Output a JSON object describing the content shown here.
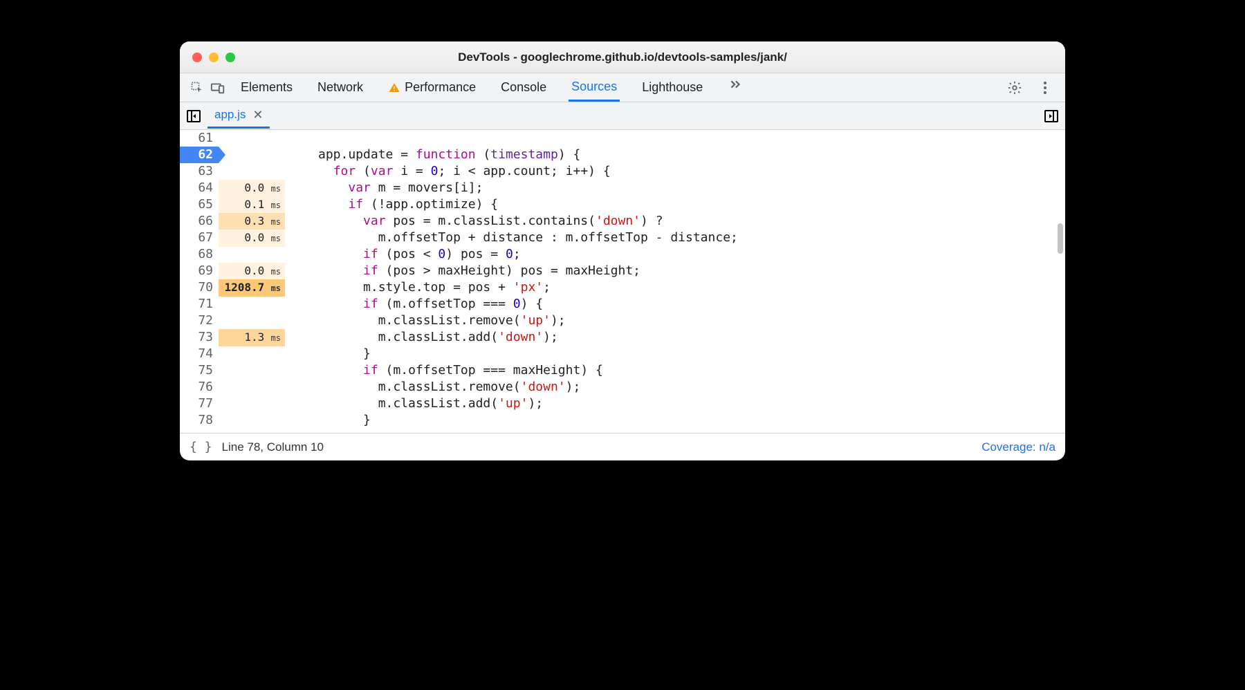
{
  "title": "DevTools - googlechrome.github.io/devtools-samples/jank/",
  "tabs": {
    "elements": "Elements",
    "network": "Network",
    "performance": "Performance",
    "console": "Console",
    "sources": "Sources",
    "lighthouse": "Lighthouse"
  },
  "file_tab": "app.js",
  "lines": [
    {
      "num": "61",
      "timing": "",
      "timing_class": "",
      "tokens": []
    },
    {
      "num": "62",
      "timing": "",
      "timing_class": "",
      "marked": true,
      "tokens": [
        {
          "t": "app.update = "
        },
        {
          "t": "function",
          "c": "kw"
        },
        {
          "t": " ("
        },
        {
          "t": "timestamp",
          "c": "arg"
        },
        {
          "t": ") {"
        }
      ]
    },
    {
      "num": "63",
      "timing": "",
      "timing_class": "",
      "tokens": [
        {
          "t": "  "
        },
        {
          "t": "for",
          "c": "kw"
        },
        {
          "t": " ("
        },
        {
          "t": "var",
          "c": "kw"
        },
        {
          "t": " i = "
        },
        {
          "t": "0",
          "c": "num"
        },
        {
          "t": "; i < app.count; i++) {"
        }
      ]
    },
    {
      "num": "64",
      "timing": "0.0",
      "timing_class": "h1",
      "unit": "ms",
      "tokens": [
        {
          "t": "    "
        },
        {
          "t": "var",
          "c": "kw"
        },
        {
          "t": " m = movers[i];"
        }
      ]
    },
    {
      "num": "65",
      "timing": "0.1",
      "timing_class": "h1",
      "unit": "ms",
      "tokens": [
        {
          "t": "    "
        },
        {
          "t": "if",
          "c": "kw"
        },
        {
          "t": " (!app.optimize) {"
        }
      ]
    },
    {
      "num": "66",
      "timing": "0.3",
      "timing_class": "h2",
      "unit": "ms",
      "tokens": [
        {
          "t": "      "
        },
        {
          "t": "var",
          "c": "kw"
        },
        {
          "t": " pos = m.classList.contains("
        },
        {
          "t": "'down'",
          "c": "str"
        },
        {
          "t": ") ?"
        }
      ]
    },
    {
      "num": "67",
      "timing": "0.0",
      "timing_class": "h1",
      "unit": "ms",
      "tokens": [
        {
          "t": "        m.offsetTop + distance : m.offsetTop - distance;"
        }
      ]
    },
    {
      "num": "68",
      "timing": "",
      "timing_class": "",
      "tokens": [
        {
          "t": "      "
        },
        {
          "t": "if",
          "c": "kw"
        },
        {
          "t": " (pos < "
        },
        {
          "t": "0",
          "c": "num"
        },
        {
          "t": ") pos = "
        },
        {
          "t": "0",
          "c": "num"
        },
        {
          "t": ";"
        }
      ]
    },
    {
      "num": "69",
      "timing": "0.0",
      "timing_class": "h1",
      "unit": "ms",
      "tokens": [
        {
          "t": "      "
        },
        {
          "t": "if",
          "c": "kw"
        },
        {
          "t": " (pos > maxHeight) pos = maxHeight;"
        }
      ]
    },
    {
      "num": "70",
      "timing": "1208.7",
      "timing_class": "h4",
      "unit": "ms",
      "tokens": [
        {
          "t": "      m.style.top = pos + "
        },
        {
          "t": "'px'",
          "c": "str"
        },
        {
          "t": ";"
        }
      ]
    },
    {
      "num": "71",
      "timing": "",
      "timing_class": "",
      "tokens": [
        {
          "t": "      "
        },
        {
          "t": "if",
          "c": "kw"
        },
        {
          "t": " (m.offsetTop === "
        },
        {
          "t": "0",
          "c": "num"
        },
        {
          "t": ") {"
        }
      ]
    },
    {
      "num": "72",
      "timing": "",
      "timing_class": "",
      "tokens": [
        {
          "t": "        m.classList.remove("
        },
        {
          "t": "'up'",
          "c": "str"
        },
        {
          "t": ");"
        }
      ]
    },
    {
      "num": "73",
      "timing": "1.3",
      "timing_class": "h3",
      "unit": "ms",
      "tokens": [
        {
          "t": "        m.classList.add("
        },
        {
          "t": "'down'",
          "c": "str"
        },
        {
          "t": ");"
        }
      ]
    },
    {
      "num": "74",
      "timing": "",
      "timing_class": "",
      "tokens": [
        {
          "t": "      }"
        }
      ]
    },
    {
      "num": "75",
      "timing": "",
      "timing_class": "",
      "tokens": [
        {
          "t": "      "
        },
        {
          "t": "if",
          "c": "kw"
        },
        {
          "t": " (m.offsetTop === maxHeight) {"
        }
      ]
    },
    {
      "num": "76",
      "timing": "",
      "timing_class": "",
      "tokens": [
        {
          "t": "        m.classList.remove("
        },
        {
          "t": "'down'",
          "c": "str"
        },
        {
          "t": ");"
        }
      ]
    },
    {
      "num": "77",
      "timing": "",
      "timing_class": "",
      "tokens": [
        {
          "t": "        m.classList.add("
        },
        {
          "t": "'up'",
          "c": "str"
        },
        {
          "t": ");"
        }
      ]
    },
    {
      "num": "78",
      "timing": "",
      "timing_class": "",
      "tokens": [
        {
          "t": "      }"
        }
      ]
    }
  ],
  "status": {
    "position": "Line 78, Column 10",
    "coverage": "Coverage: n/a"
  }
}
